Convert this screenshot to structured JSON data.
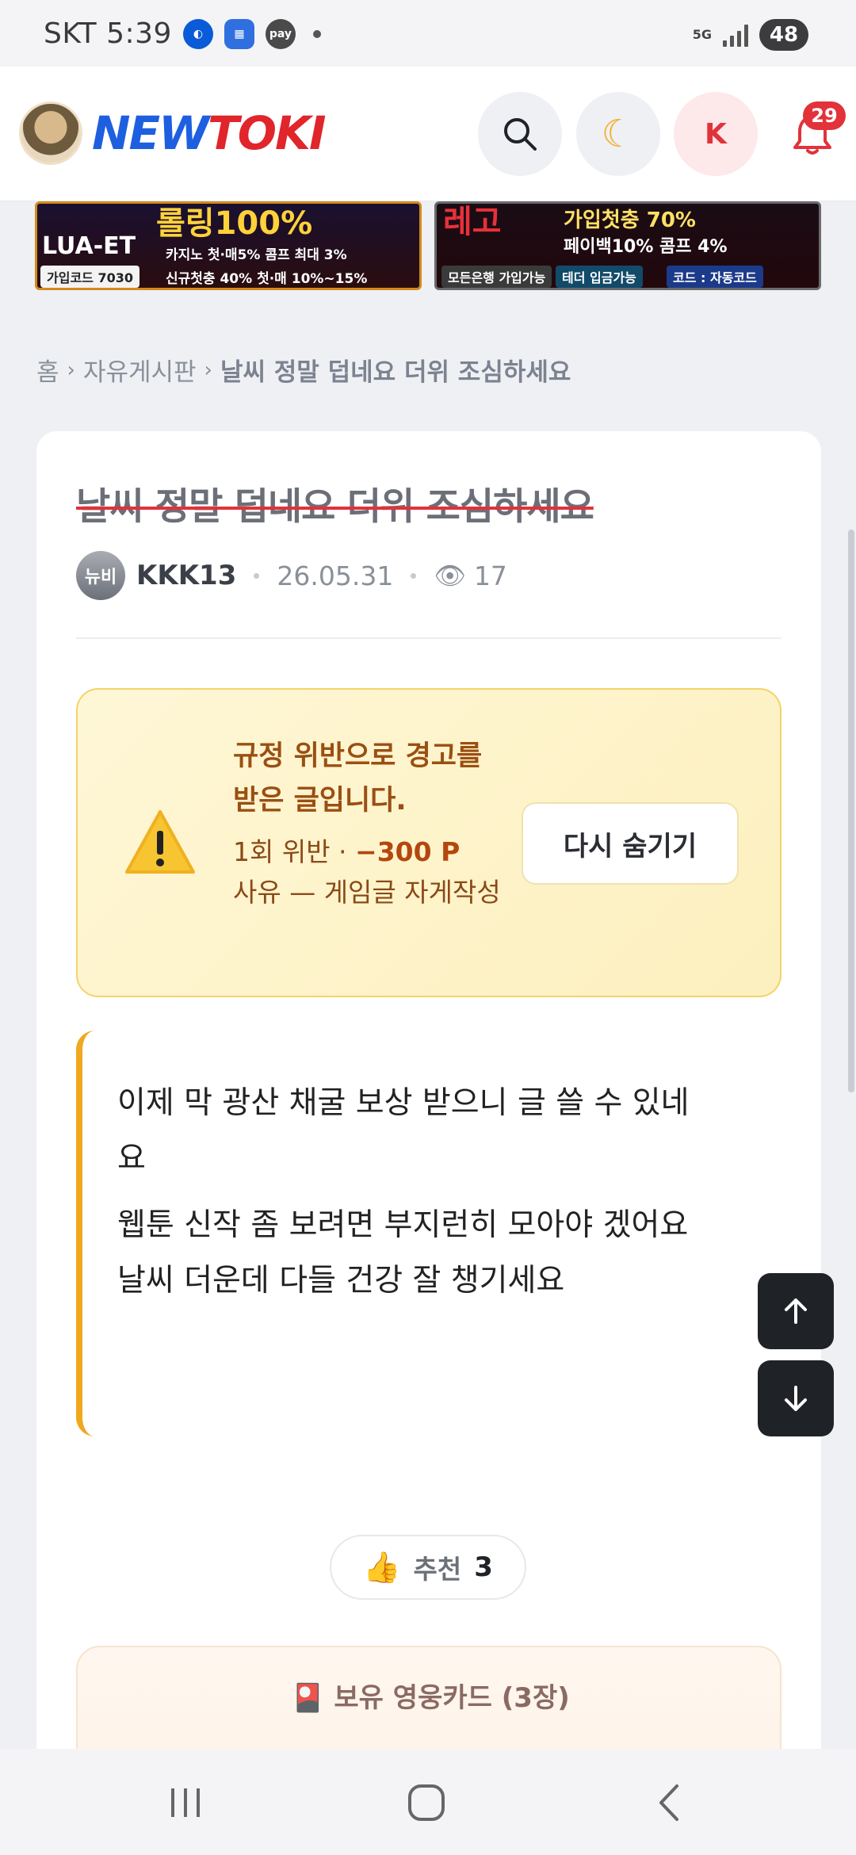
{
  "status_bar": {
    "carrier_time": "SKT 5:39",
    "network": "5G",
    "battery": "48"
  },
  "header": {
    "logo_part1": "NEW",
    "logo_part2": "TOKI",
    "user_initial": "K",
    "notification_count": "29"
  },
  "banners": {
    "left": {
      "big": "롤링100%",
      "brand": "LUA-ET",
      "line1": "카지노 첫·매5% 콤프 최대 3%",
      "line2": "신규첫충 40% 첫·매 10%~15%",
      "code": "가입코드 7030"
    },
    "right": {
      "big": "레고",
      "line1": "가입첫충 70%",
      "line2": "페이백10% 콤프 4%",
      "tag1": "모든은행 가입가능",
      "tag2": "테더 입금가능",
      "tag3": "코드 : 자동코드"
    }
  },
  "breadcrumb": {
    "home": "홈",
    "board": "자유게시판",
    "current": "날씨 정말 덥네요 더위 조심하세요"
  },
  "post": {
    "title": "날씨 정말 덥네요 더위 조심하세요",
    "badge": "뉴비",
    "author": "KKK13",
    "date": "26.05.31",
    "views": "17"
  },
  "warning": {
    "title": "규정 위반으로 경고를 받은 글입니다.",
    "count_text": "1회 위반 · ",
    "points": "−300 P",
    "reason": "사유 — 게임글 자게작성",
    "hide_button": "다시 숨기기"
  },
  "content": {
    "lines": [
      "이제 막 광산 채굴 보상 받으니 글 쓸 수 있네",
      "요",
      "웹툰 신작 좀 보려면 부지런히 모아야 겠어요",
      "날씨 더운데 다들 건강 잘 챙기세요"
    ]
  },
  "recommend": {
    "label": "추천",
    "count": "3"
  },
  "hero_cards": {
    "title": "🎴 보유 영웅카드 (3장)"
  },
  "colors": {
    "brand_blue": "#1e5fe0",
    "brand_red": "#e2323a",
    "warning_bg": "#fef7d6",
    "accent_orange": "#f0a81e"
  }
}
